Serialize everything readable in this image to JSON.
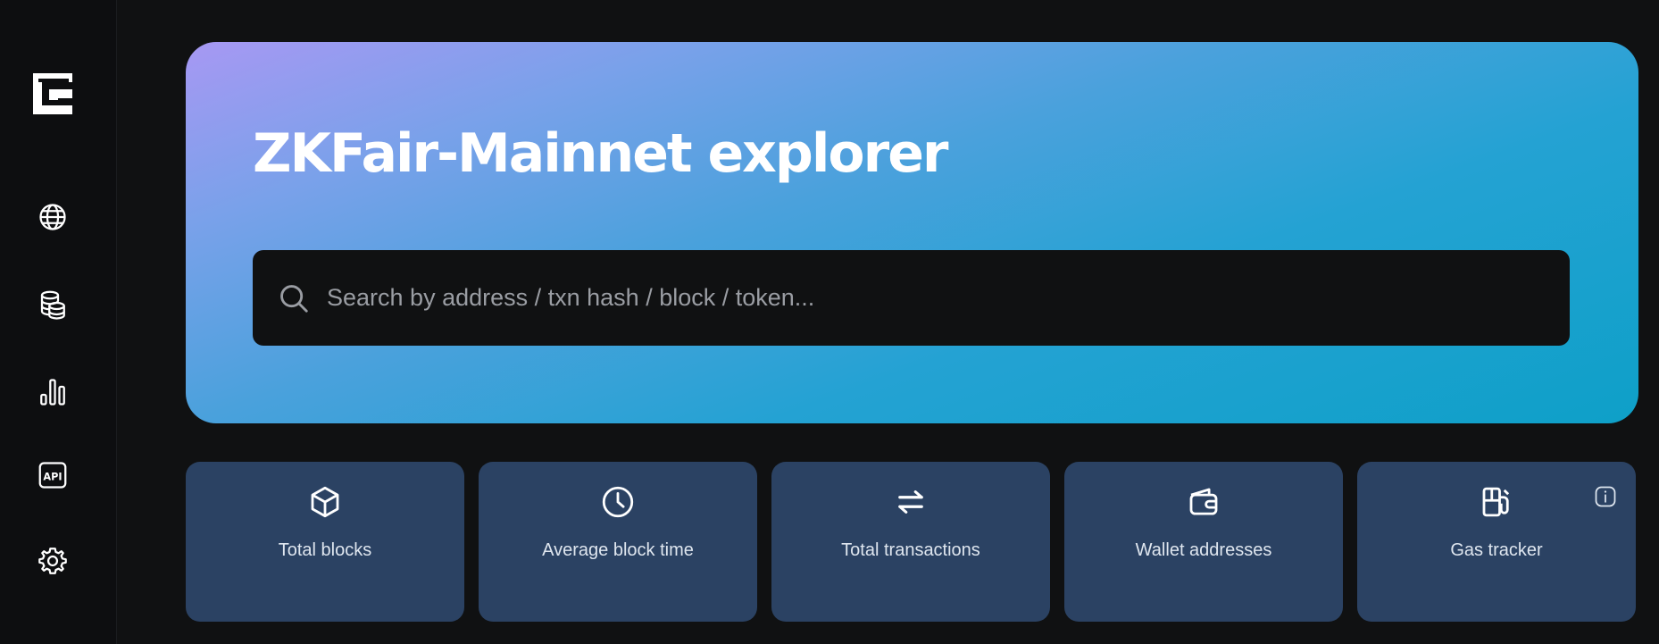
{
  "hero": {
    "title": "ZKFair-Mainnet explorer"
  },
  "search": {
    "placeholder": "Search by address / txn hash / block / token..."
  },
  "sidebar": {
    "logo": "zkfair-logo",
    "items": [
      {
        "icon": "globe-icon"
      },
      {
        "icon": "coins-icon"
      },
      {
        "icon": "bar-chart-icon"
      },
      {
        "icon": "api-icon",
        "text": "API"
      },
      {
        "icon": "gear-icon"
      }
    ]
  },
  "stats": [
    {
      "icon": "cube-icon",
      "label": "Total blocks"
    },
    {
      "icon": "clock-icon",
      "label": "Average block time"
    },
    {
      "icon": "arrows-swap-icon",
      "label": "Total transactions"
    },
    {
      "icon": "wallet-icon",
      "label": "Wallet addresses"
    },
    {
      "icon": "gas-pump-icon",
      "label": "Gas tracker"
    }
  ],
  "colors": {
    "background": "#101112",
    "sidebar": "#0d0e10",
    "card": "#2b4263",
    "gradient_start": "#a798f3",
    "gradient_end": "#0ea0c8",
    "search_bg": "#101112"
  }
}
